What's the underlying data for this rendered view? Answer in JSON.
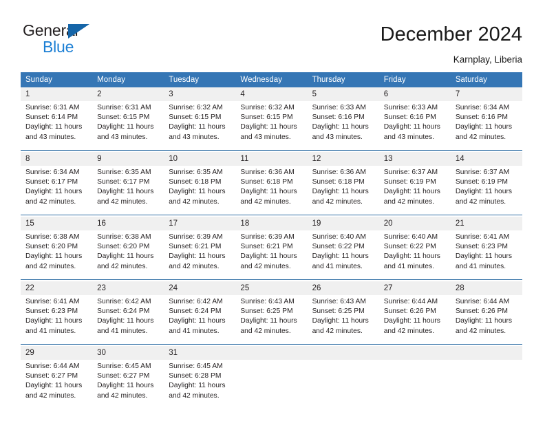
{
  "logo": {
    "word1": "General",
    "word2": "Blue",
    "triangle_color": "#1565a8",
    "word2_color": "#1c7fd4"
  },
  "header": {
    "title": "December 2024",
    "location": "Karnplay, Liberia"
  },
  "theme": {
    "header_bg": "#3576b5",
    "daynum_bg": "#f0f0f0",
    "separator": "#2e6da4"
  },
  "weekdays": [
    "Sunday",
    "Monday",
    "Tuesday",
    "Wednesday",
    "Thursday",
    "Friday",
    "Saturday"
  ],
  "weeks": [
    [
      {
        "day": "1",
        "sunrise": "Sunrise: 6:31 AM",
        "sunset": "Sunset: 6:14 PM",
        "daylight1": "Daylight: 11 hours",
        "daylight2": "and 43 minutes."
      },
      {
        "day": "2",
        "sunrise": "Sunrise: 6:31 AM",
        "sunset": "Sunset: 6:15 PM",
        "daylight1": "Daylight: 11 hours",
        "daylight2": "and 43 minutes."
      },
      {
        "day": "3",
        "sunrise": "Sunrise: 6:32 AM",
        "sunset": "Sunset: 6:15 PM",
        "daylight1": "Daylight: 11 hours",
        "daylight2": "and 43 minutes."
      },
      {
        "day": "4",
        "sunrise": "Sunrise: 6:32 AM",
        "sunset": "Sunset: 6:15 PM",
        "daylight1": "Daylight: 11 hours",
        "daylight2": "and 43 minutes."
      },
      {
        "day": "5",
        "sunrise": "Sunrise: 6:33 AM",
        "sunset": "Sunset: 6:16 PM",
        "daylight1": "Daylight: 11 hours",
        "daylight2": "and 43 minutes."
      },
      {
        "day": "6",
        "sunrise": "Sunrise: 6:33 AM",
        "sunset": "Sunset: 6:16 PM",
        "daylight1": "Daylight: 11 hours",
        "daylight2": "and 43 minutes."
      },
      {
        "day": "7",
        "sunrise": "Sunrise: 6:34 AM",
        "sunset": "Sunset: 6:16 PM",
        "daylight1": "Daylight: 11 hours",
        "daylight2": "and 42 minutes."
      }
    ],
    [
      {
        "day": "8",
        "sunrise": "Sunrise: 6:34 AM",
        "sunset": "Sunset: 6:17 PM",
        "daylight1": "Daylight: 11 hours",
        "daylight2": "and 42 minutes."
      },
      {
        "day": "9",
        "sunrise": "Sunrise: 6:35 AM",
        "sunset": "Sunset: 6:17 PM",
        "daylight1": "Daylight: 11 hours",
        "daylight2": "and 42 minutes."
      },
      {
        "day": "10",
        "sunrise": "Sunrise: 6:35 AM",
        "sunset": "Sunset: 6:18 PM",
        "daylight1": "Daylight: 11 hours",
        "daylight2": "and 42 minutes."
      },
      {
        "day": "11",
        "sunrise": "Sunrise: 6:36 AM",
        "sunset": "Sunset: 6:18 PM",
        "daylight1": "Daylight: 11 hours",
        "daylight2": "and 42 minutes."
      },
      {
        "day": "12",
        "sunrise": "Sunrise: 6:36 AM",
        "sunset": "Sunset: 6:18 PM",
        "daylight1": "Daylight: 11 hours",
        "daylight2": "and 42 minutes."
      },
      {
        "day": "13",
        "sunrise": "Sunrise: 6:37 AM",
        "sunset": "Sunset: 6:19 PM",
        "daylight1": "Daylight: 11 hours",
        "daylight2": "and 42 minutes."
      },
      {
        "day": "14",
        "sunrise": "Sunrise: 6:37 AM",
        "sunset": "Sunset: 6:19 PM",
        "daylight1": "Daylight: 11 hours",
        "daylight2": "and 42 minutes."
      }
    ],
    [
      {
        "day": "15",
        "sunrise": "Sunrise: 6:38 AM",
        "sunset": "Sunset: 6:20 PM",
        "daylight1": "Daylight: 11 hours",
        "daylight2": "and 42 minutes."
      },
      {
        "day": "16",
        "sunrise": "Sunrise: 6:38 AM",
        "sunset": "Sunset: 6:20 PM",
        "daylight1": "Daylight: 11 hours",
        "daylight2": "and 42 minutes."
      },
      {
        "day": "17",
        "sunrise": "Sunrise: 6:39 AM",
        "sunset": "Sunset: 6:21 PM",
        "daylight1": "Daylight: 11 hours",
        "daylight2": "and 42 minutes."
      },
      {
        "day": "18",
        "sunrise": "Sunrise: 6:39 AM",
        "sunset": "Sunset: 6:21 PM",
        "daylight1": "Daylight: 11 hours",
        "daylight2": "and 42 minutes."
      },
      {
        "day": "19",
        "sunrise": "Sunrise: 6:40 AM",
        "sunset": "Sunset: 6:22 PM",
        "daylight1": "Daylight: 11 hours",
        "daylight2": "and 41 minutes."
      },
      {
        "day": "20",
        "sunrise": "Sunrise: 6:40 AM",
        "sunset": "Sunset: 6:22 PM",
        "daylight1": "Daylight: 11 hours",
        "daylight2": "and 41 minutes."
      },
      {
        "day": "21",
        "sunrise": "Sunrise: 6:41 AM",
        "sunset": "Sunset: 6:23 PM",
        "daylight1": "Daylight: 11 hours",
        "daylight2": "and 41 minutes."
      }
    ],
    [
      {
        "day": "22",
        "sunrise": "Sunrise: 6:41 AM",
        "sunset": "Sunset: 6:23 PM",
        "daylight1": "Daylight: 11 hours",
        "daylight2": "and 41 minutes."
      },
      {
        "day": "23",
        "sunrise": "Sunrise: 6:42 AM",
        "sunset": "Sunset: 6:24 PM",
        "daylight1": "Daylight: 11 hours",
        "daylight2": "and 41 minutes."
      },
      {
        "day": "24",
        "sunrise": "Sunrise: 6:42 AM",
        "sunset": "Sunset: 6:24 PM",
        "daylight1": "Daylight: 11 hours",
        "daylight2": "and 41 minutes."
      },
      {
        "day": "25",
        "sunrise": "Sunrise: 6:43 AM",
        "sunset": "Sunset: 6:25 PM",
        "daylight1": "Daylight: 11 hours",
        "daylight2": "and 42 minutes."
      },
      {
        "day": "26",
        "sunrise": "Sunrise: 6:43 AM",
        "sunset": "Sunset: 6:25 PM",
        "daylight1": "Daylight: 11 hours",
        "daylight2": "and 42 minutes."
      },
      {
        "day": "27",
        "sunrise": "Sunrise: 6:44 AM",
        "sunset": "Sunset: 6:26 PM",
        "daylight1": "Daylight: 11 hours",
        "daylight2": "and 42 minutes."
      },
      {
        "day": "28",
        "sunrise": "Sunrise: 6:44 AM",
        "sunset": "Sunset: 6:26 PM",
        "daylight1": "Daylight: 11 hours",
        "daylight2": "and 42 minutes."
      }
    ],
    [
      {
        "day": "29",
        "sunrise": "Sunrise: 6:44 AM",
        "sunset": "Sunset: 6:27 PM",
        "daylight1": "Daylight: 11 hours",
        "daylight2": "and 42 minutes."
      },
      {
        "day": "30",
        "sunrise": "Sunrise: 6:45 AM",
        "sunset": "Sunset: 6:27 PM",
        "daylight1": "Daylight: 11 hours",
        "daylight2": "and 42 minutes."
      },
      {
        "day": "31",
        "sunrise": "Sunrise: 6:45 AM",
        "sunset": "Sunset: 6:28 PM",
        "daylight1": "Daylight: 11 hours",
        "daylight2": "and 42 minutes."
      },
      {
        "day": "",
        "sunrise": "",
        "sunset": "",
        "daylight1": "",
        "daylight2": ""
      },
      {
        "day": "",
        "sunrise": "",
        "sunset": "",
        "daylight1": "",
        "daylight2": ""
      },
      {
        "day": "",
        "sunrise": "",
        "sunset": "",
        "daylight1": "",
        "daylight2": ""
      },
      {
        "day": "",
        "sunrise": "",
        "sunset": "",
        "daylight1": "",
        "daylight2": ""
      }
    ]
  ]
}
